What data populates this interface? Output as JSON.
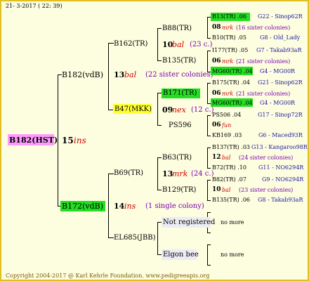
{
  "header": {
    "date": "21-  3-2017 ( 22: 39)"
  },
  "footer": {
    "copyright": "Copyright 2004-2017 @ Karl Kehrle Foundation.   www.pedigreeapis.org"
  },
  "root": {
    "id": "B182(HST)",
    "year": "15",
    "breed": "ins"
  },
  "gen1": [
    {
      "id": "B182(vdB)",
      "year": "13",
      "breed": "bal",
      "note": "(22 sister colonies)"
    },
    {
      "id": "B172(vdB)",
      "year": "14",
      "breed": "ins",
      "note": "(1 single colony)"
    }
  ],
  "gen2": [
    {
      "id": "B162(TR)"
    },
    {
      "id": "B47(MKK)",
      "year": "09",
      "breed": "nex",
      "note": "(12 c.)"
    },
    {
      "id": "B69(TR)"
    },
    {
      "id": "EL685(JBB)",
      "year": "12"
    }
  ],
  "gen3": [
    {
      "id": "B88(TR)",
      "year": "10",
      "breed": "bal",
      "note": "(23 c.)"
    },
    {
      "id": "B135(TR)"
    },
    {
      "id": "B171(TR)"
    },
    {
      "id": "PS596",
      "year": "06",
      "breed": "fun"
    },
    {
      "id": "B63(TR)"
    },
    {
      "id": "B129(TR)"
    },
    {
      "id": "Not registered"
    },
    {
      "id": "Elgon bee"
    }
  ],
  "gen4": [
    {
      "text": "B13(TR) .06",
      "right": "G22 - Sinop62R"
    },
    {
      "year": "08",
      "breed": "mrk",
      "note": "(16 sister colonies)"
    },
    {
      "text": "B10(TR) .05",
      "right": "G8 - Old_Lady"
    },
    {
      "text": "I177(TR) .05",
      "right": "G7 - Takab93aR"
    },
    {
      "year": "06",
      "breed": "mrk",
      "note": "(21 sister colonies)"
    },
    {
      "text": "MG60(TR) .04",
      "right": "G4 - MG00R"
    },
    {
      "text": "B175(TR) .04",
      "right": "G21 - Sinop62R"
    },
    {
      "year": "06",
      "breed": "mrk",
      "note": "(21 sister colonies)"
    },
    {
      "text": "MG60(TR) .04",
      "right": "G4 - MG00R"
    },
    {
      "text": "PS506 .04",
      "right": "G17 - Sinop72R"
    },
    {
      "text": "KB169 .03",
      "right": "G6 - Maced93R"
    },
    {
      "text": "B137(TR) .03",
      "right": "G13 - Kangaroo98R"
    },
    {
      "year": "12",
      "breed": "bal",
      "note": "(24 sister colonies)"
    },
    {
      "text": "B72(TR) .10",
      "right": "G11 - NO6294R"
    },
    {
      "text": "B82(TR) .07",
      "right": "G9 - NO6294R"
    },
    {
      "year": "10",
      "breed": "bal",
      "note": "(23 sister colonies)"
    },
    {
      "text": "B135(TR) .06",
      "right": "G8 - Takab93aR"
    },
    {
      "text": "no more"
    },
    {
      "text": "no more"
    }
  ],
  "gen3_years": [
    {
      "year": "13",
      "breed": "mrk",
      "note": "(24 c.)"
    }
  ]
}
